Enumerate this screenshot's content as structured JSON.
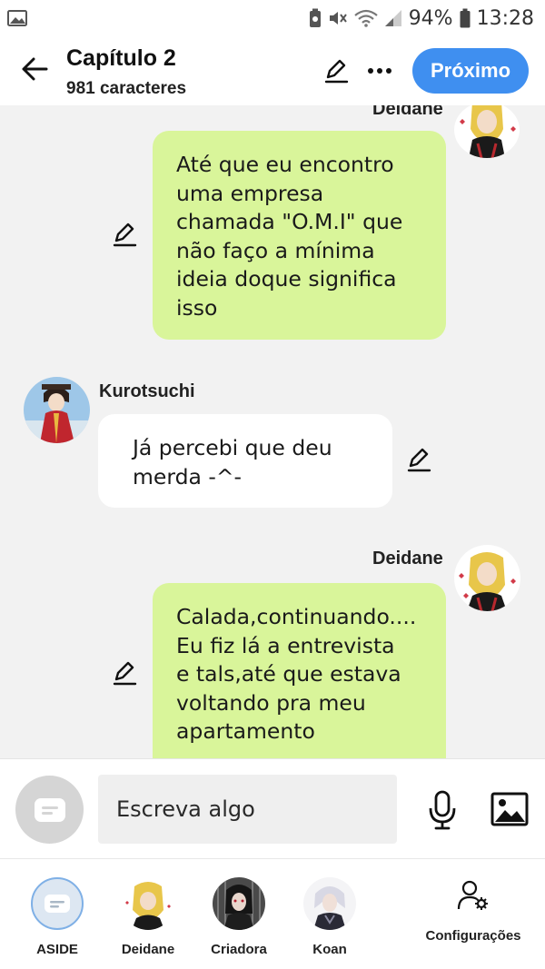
{
  "status_bar": {
    "battery": "94%",
    "time": "13:28"
  },
  "header": {
    "title": "Capítulo 2",
    "subtitle": "981 caracteres",
    "next_label": "Próximo"
  },
  "messages": [
    {
      "sender": "Deidane",
      "side": "right",
      "lines": [
        "Até que eu encontro",
        "uma empresa",
        "chamada \"O.M.I\" que",
        "não faço a mínima",
        "ideia doque significa",
        "isso"
      ]
    },
    {
      "sender": "Kurotsuchi",
      "side": "left",
      "lines": [
        "Já percebi que deu",
        "merda -^-"
      ]
    },
    {
      "sender": "Deidane",
      "side": "right",
      "lines": [
        "Calada,continuando....",
        "Eu fiz lá a entrevista",
        "e tals,até que estava",
        "voltando pra meu",
        "apartamento"
      ]
    }
  ],
  "composer": {
    "placeholder": "Escreva algo"
  },
  "characters": [
    {
      "label": "ASIDE"
    },
    {
      "label": "Deidane"
    },
    {
      "label": "Criadora"
    },
    {
      "label": "Koan"
    }
  ],
  "settings_label": "Configurações",
  "colors": {
    "accent": "#3f8ff0",
    "bubble_green": "#d9f59a",
    "bubble_white": "#ffffff",
    "background": "#f2f2f2"
  }
}
